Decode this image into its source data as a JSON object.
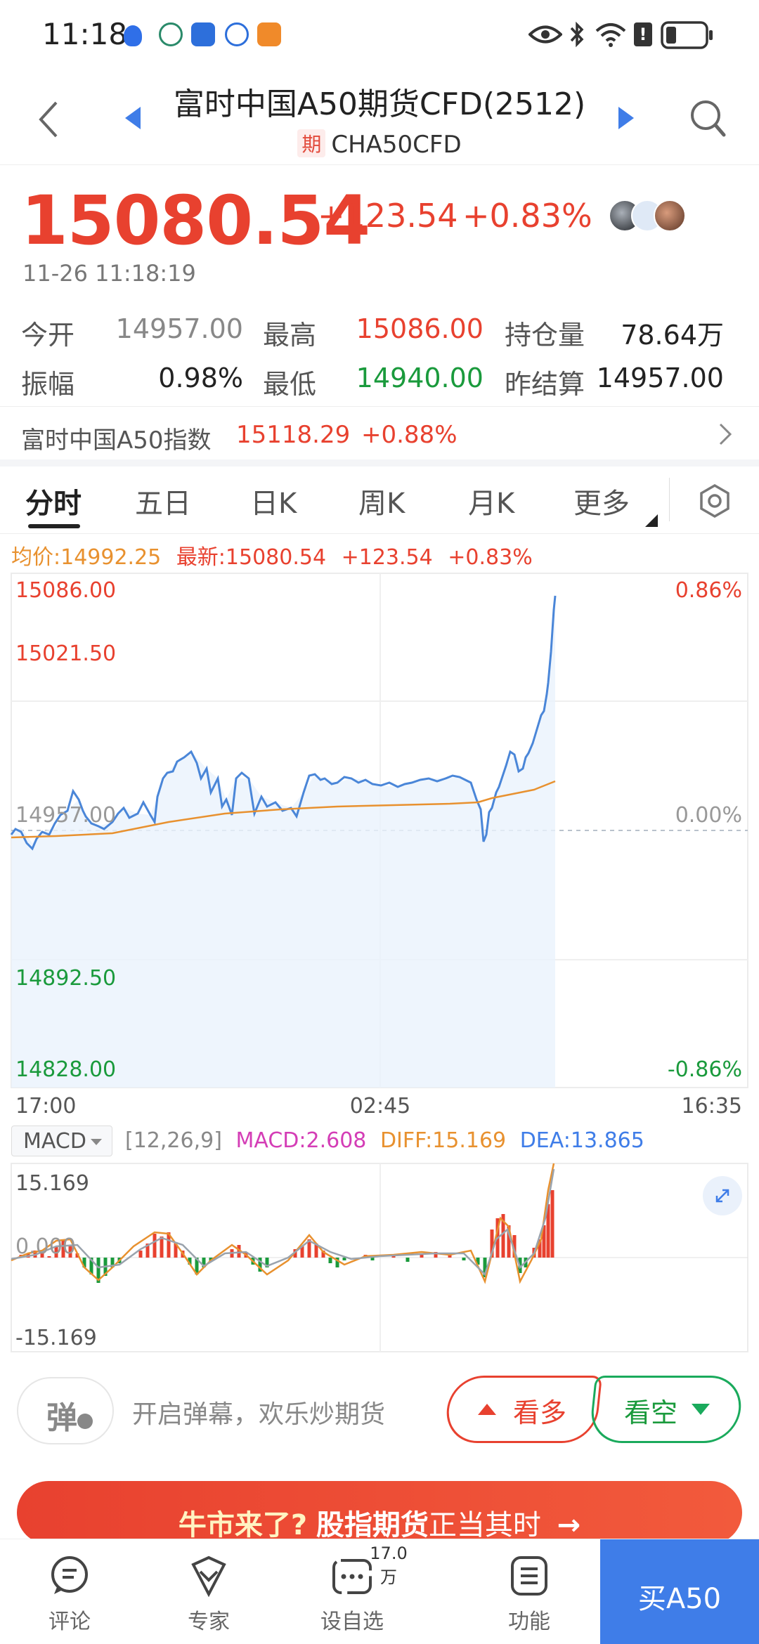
{
  "status_bar": {
    "time": "11:18"
  },
  "header": {
    "title": "富时中国A50期货CFD(2512)",
    "tag": "期",
    "code": "CHA50CFD"
  },
  "quote": {
    "price": "15080.54",
    "change": "+123.54",
    "change_pct": "+0.83%",
    "datetime": "11-26 11:18:19"
  },
  "stats": {
    "open_label": "今开",
    "open": "14957.00",
    "high_label": "最高",
    "high": "15086.00",
    "oi_label": "持仓量",
    "oi": "78.64万",
    "amp_label": "振幅",
    "amp": "0.98%",
    "low_label": "最低",
    "low": "14940.00",
    "settle_label": "昨结算",
    "settle": "14957.00"
  },
  "index_row": {
    "name": "富时中国A50指数",
    "value": "15118.29",
    "pct": "+0.88%"
  },
  "tabs": [
    "分时",
    "五日",
    "日K",
    "周K",
    "月K",
    "更多"
  ],
  "legend": {
    "avg": "均价:14992.25",
    "latest": "最新:15080.54",
    "change": "+123.54",
    "pct": "+0.83%"
  },
  "chart_data": {
    "type": "line",
    "y_ticks_left": [
      "15086.00",
      "15021.50",
      "14957.00",
      "14892.50",
      "14828.00"
    ],
    "y_ticks_right": [
      "0.86%",
      "0.00%",
      "-0.86%"
    ],
    "x_ticks": [
      "17:00",
      "02:45",
      "16:35"
    ],
    "ylim": [
      14828.0,
      15086.0
    ],
    "baseline": 14957.0,
    "series": [
      {
        "name": "最新",
        "color": "#4a86d8"
      },
      {
        "name": "均价",
        "color": "#e8912f"
      }
    ]
  },
  "macd": {
    "selector": "MACD",
    "params": "[12,26,9]",
    "macd": "MACD:2.608",
    "diff": "DIFF:15.169",
    "dea": "DEA:13.865",
    "top": "15.169",
    "zero": "0.000",
    "bottom": "-15.169"
  },
  "comment": {
    "danmu_icon": "弹",
    "placeholder": "开启弹幕，欢乐炒期货",
    "bull": "看多",
    "bear": "看空"
  },
  "banner": {
    "part1": "牛市来了?",
    "part2": "股指期货",
    "part3": "正当其时"
  },
  "bottom_nav": {
    "comment": "评论",
    "expert": "专家",
    "watch": "设自选",
    "watch_count": "17.0万",
    "func": "功能",
    "buy": "买A50"
  },
  "colors": {
    "up": "#e8412f",
    "down": "#1a9a3c",
    "accent": "#3f7de8",
    "avg": "#e8912f"
  }
}
